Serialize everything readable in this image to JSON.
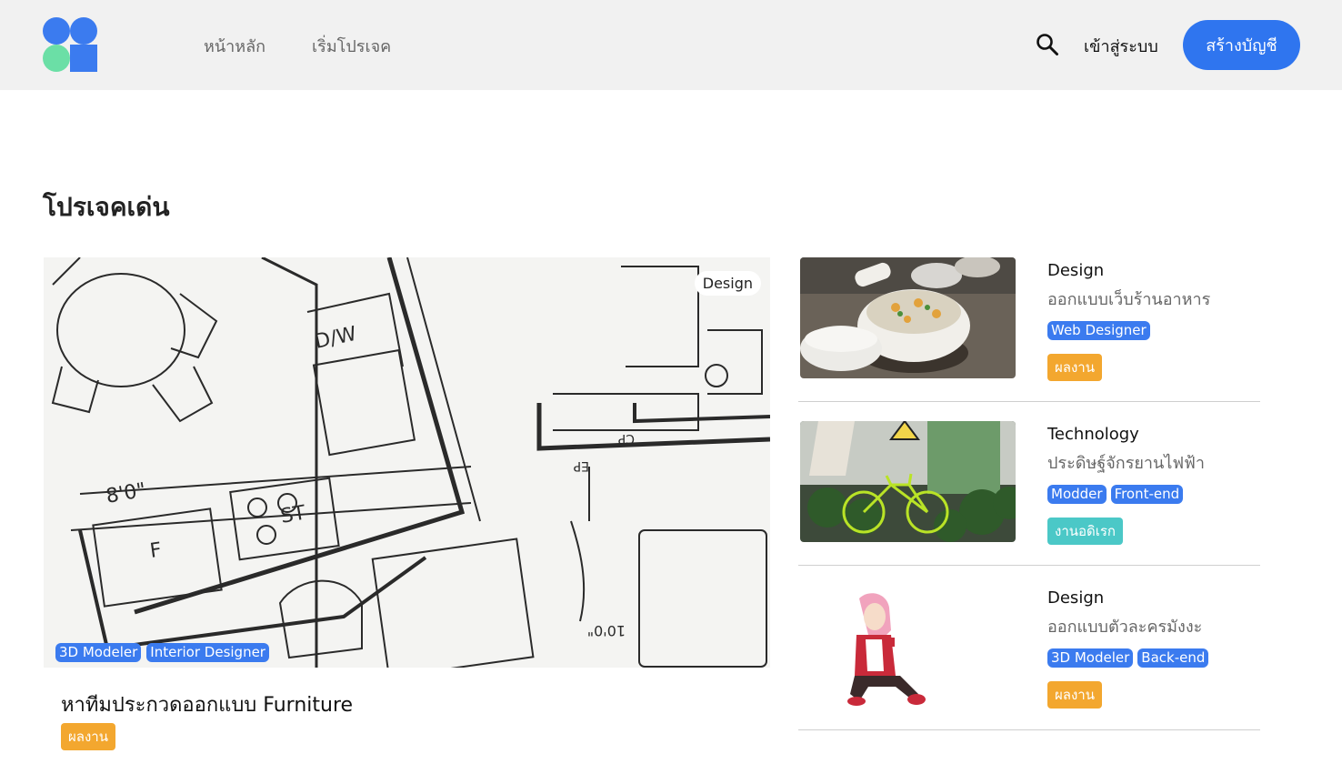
{
  "nav": {
    "home": "หน้าหลัก",
    "start_project": "เริ่มโปรเจค",
    "login": "เข้าสู่ระบบ",
    "signup": "สร้างบัญชี",
    "search_icon": "search-icon"
  },
  "section_title": "โปรเจคเด่น",
  "featured": {
    "category": "Design",
    "tags": [
      "3D Modeler",
      "Interior Designer"
    ],
    "title": "หาทีมประกวดออกแบบ Furniture",
    "status": "ผลงาน"
  },
  "side_projects": [
    {
      "category": "Design",
      "title": "ออกแบบเว็บร้านอาหาร",
      "tags": [
        "Web Designer"
      ],
      "status": "ผลงาน"
    },
    {
      "category": "Technology",
      "title": "ประดิษฐ์จักรยานไฟฟ้า",
      "tags": [
        "Modder",
        "Front-end"
      ],
      "status": "งานอดิเรก"
    },
    {
      "category": "Design",
      "title": "ออกแบบตัวละครมังงะ",
      "tags": [
        "3D Modeler",
        "Back-end"
      ],
      "status": "ผลงาน"
    }
  ],
  "colors": {
    "primary": "#2f75ef",
    "tag": "#3b7bef",
    "status_orange": "#f3a72f",
    "status_teal": "#4bc8c7",
    "logo_green": "#6bdfa6"
  }
}
